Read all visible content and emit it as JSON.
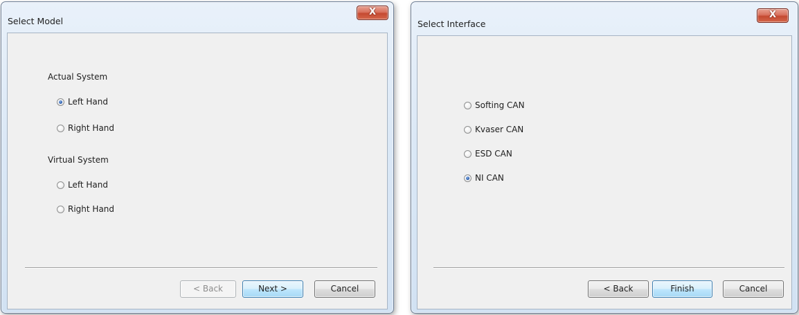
{
  "window_select_model": {
    "title": "Select Model",
    "close_label": "X",
    "actual_system": {
      "heading": "Actual System",
      "options": [
        {
          "label": "Left Hand",
          "selected": true
        },
        {
          "label": "Right Hand",
          "selected": false
        }
      ]
    },
    "virtual_system": {
      "heading": "Virtual System",
      "options": [
        {
          "label": "Left Hand",
          "selected": false
        },
        {
          "label": "Right Hand",
          "selected": false
        }
      ]
    },
    "buttons": {
      "back": "< Back",
      "back_enabled": false,
      "next": "Next >",
      "cancel": "Cancel"
    }
  },
  "window_select_interface": {
    "title": "Select Interface",
    "close_label": "X",
    "options": [
      {
        "label": "Softing CAN",
        "selected": false
      },
      {
        "label": "Kvaser CAN",
        "selected": false
      },
      {
        "label": "ESD CAN",
        "selected": false
      },
      {
        "label": "NI CAN",
        "selected": true
      }
    ],
    "buttons": {
      "back": "< Back",
      "finish": "Finish",
      "cancel": "Cancel"
    }
  },
  "colors": {
    "dialog_background": "#f0f0f0",
    "close_button": "#c44a31",
    "default_button_border": "#3c7fb1",
    "radio_selected_dot": "#2b5fb0"
  }
}
